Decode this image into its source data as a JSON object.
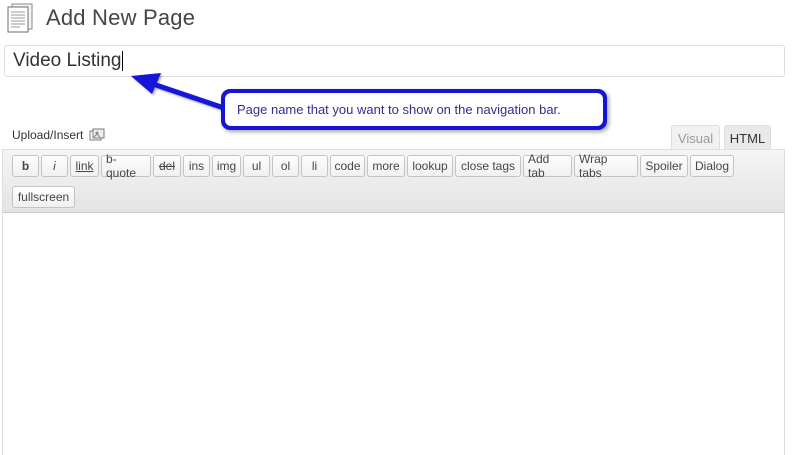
{
  "page": {
    "title": "Add New Page",
    "icon": "page-document-icon"
  },
  "title_field": {
    "value": "Video Listing"
  },
  "callout": {
    "text": "Page name that you want to show on the navigation bar.",
    "color": "#1515d8"
  },
  "media": {
    "upload_label": "Upload/Insert",
    "icon": "add-media-icon"
  },
  "tabs": [
    {
      "label": "Visual",
      "active": false
    },
    {
      "label": "HTML",
      "active": true
    }
  ],
  "toolbar": {
    "buttons": [
      {
        "id": "b",
        "label": "b"
      },
      {
        "id": "i",
        "label": "i"
      },
      {
        "id": "link",
        "label": "link"
      },
      {
        "id": "b-quote",
        "label": "b-quote"
      },
      {
        "id": "del",
        "label": "del"
      },
      {
        "id": "ins",
        "label": "ins"
      },
      {
        "id": "img",
        "label": "img"
      },
      {
        "id": "ul",
        "label": "ul"
      },
      {
        "id": "ol",
        "label": "ol"
      },
      {
        "id": "li",
        "label": "li"
      },
      {
        "id": "code",
        "label": "code"
      },
      {
        "id": "more",
        "label": "more"
      },
      {
        "id": "lookup",
        "label": "lookup"
      },
      {
        "id": "close-tags",
        "label": "close tags"
      },
      {
        "id": "add-tab",
        "label": "Add tab"
      },
      {
        "id": "wrap-tabs",
        "label": "Wrap tabs"
      },
      {
        "id": "spoiler",
        "label": "Spoiler"
      },
      {
        "id": "dialog",
        "label": "Dialog"
      },
      {
        "id": "fullscreen",
        "label": "fullscreen"
      }
    ]
  },
  "editor": {
    "content": ""
  }
}
